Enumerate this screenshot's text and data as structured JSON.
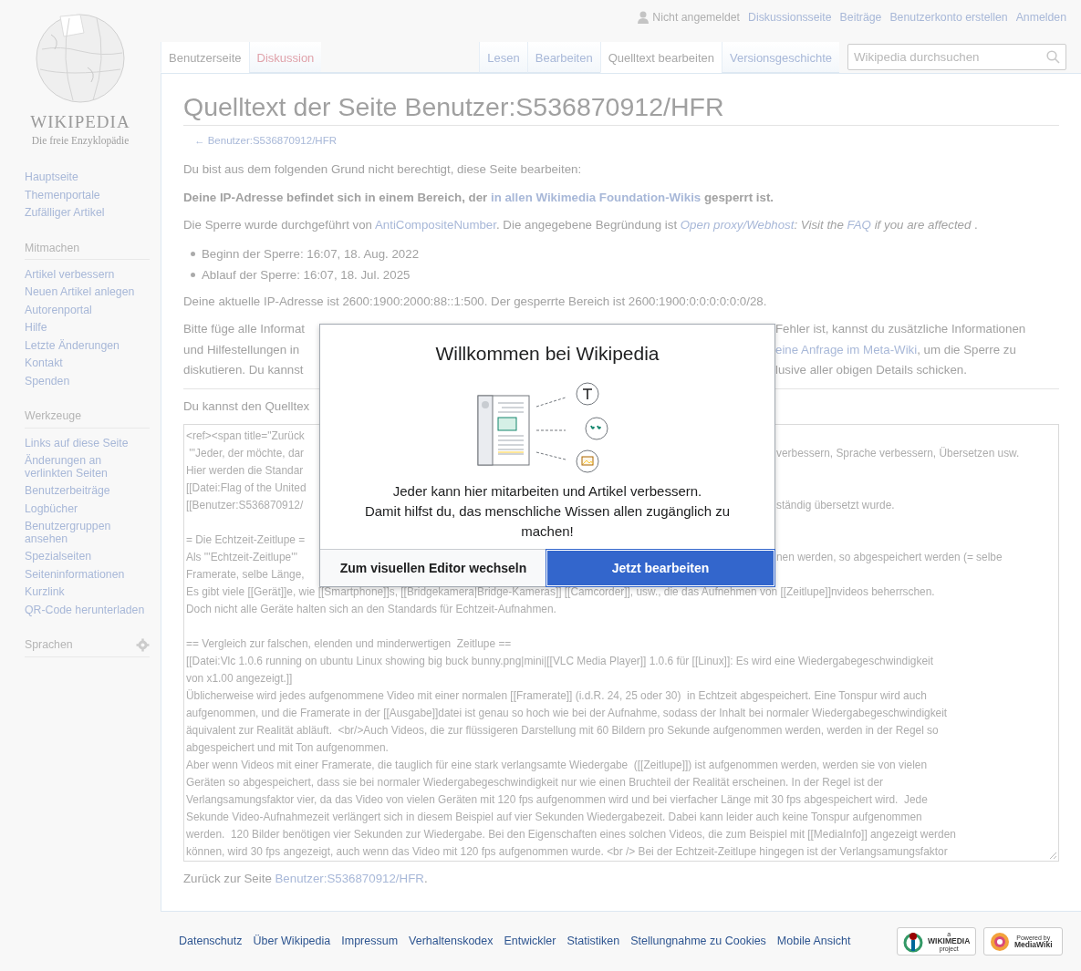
{
  "logo": {
    "wordmark": "WIKIPEDIA",
    "tagline": "Die freie Enzyklopädie"
  },
  "personal": {
    "status": "Nicht angemeldet",
    "links": [
      "Diskussionsseite",
      "Beiträge",
      "Benutzerkonto erstellen",
      "Anmelden"
    ]
  },
  "tabs_left": [
    {
      "label": "Benutzerseite",
      "selected": true,
      "kind": "existing"
    },
    {
      "label": "Diskussion",
      "selected": false,
      "kind": "missing"
    }
  ],
  "tabs_right": [
    {
      "label": "Lesen",
      "selected": false
    },
    {
      "label": "Bearbeiten",
      "selected": false
    },
    {
      "label": "Quelltext bearbeiten",
      "selected": true
    },
    {
      "label": "Versionsgeschichte",
      "selected": false
    }
  ],
  "search": {
    "placeholder": "Wikipedia durchsuchen"
  },
  "sidebar": {
    "sections": [
      {
        "items": [
          "Hauptseite",
          "Themenportale",
          "Zufälliger Artikel"
        ]
      },
      {
        "heading": "Mitmachen",
        "items": [
          "Artikel verbessern",
          "Neuen Artikel anlegen",
          "Autorenportal",
          "Hilfe",
          "Letzte Änderungen",
          "Kontakt",
          "Spenden"
        ]
      },
      {
        "heading": "Werkzeuge",
        "items": [
          "Links auf diese Seite",
          "Änderungen an verlinkten Seiten",
          "Benutzerbeiträge",
          "Logbücher",
          "Benutzergruppen ansehen",
          "Spezialseiten",
          "Seiteninformationen",
          "Kurzlink",
          "QR-Code herunterladen"
        ]
      },
      {
        "heading": "Sprachen",
        "settings": true
      }
    ]
  },
  "heading": "Quelltext der Seite Benutzer:S536870912/HFR",
  "back_link": "← Benutzer:S536870912/HFR",
  "content": [
    {
      "kind": "para",
      "bold": false,
      "lines": [
        {
          "kind": "line",
          "parts": [
            {
              "kind": "text",
              "text": "Du bist aus dem folgenden Grund nicht berechtigt, diese Seite bearbeiten:"
            }
          ]
        }
      ]
    },
    {
      "kind": "para",
      "bold": true,
      "lines": [
        {
          "kind": "line",
          "parts": [
            {
              "kind": "text",
              "text": "Deine IP-Adresse befindet sich in einem Bereich, der "
            },
            {
              "kind": "link",
              "text": "in allen Wikimedia Foundation-Wikis"
            },
            {
              "kind": "text",
              "text": " gesperrt ist."
            }
          ]
        }
      ]
    },
    {
      "kind": "para",
      "bold": false,
      "lines": [
        {
          "kind": "line",
          "parts": [
            {
              "kind": "text",
              "text": "Die Sperre wurde durchgeführt von "
            },
            {
              "kind": "link",
              "text": "AntiCompositeNumber"
            },
            {
              "kind": "text",
              "text": ". Die angegebene Begründung ist "
            },
            {
              "kind": "italic-link",
              "text": "Open proxy/Webhost"
            },
            {
              "kind": "italic",
              "text": ": Visit the "
            },
            {
              "kind": "italic-link",
              "text": "FAQ"
            },
            {
              "kind": "italic",
              "text": " if you are affected"
            },
            {
              "kind": "text",
              "text": " ."
            }
          ]
        }
      ]
    },
    {
      "kind": "list",
      "items": [
        "Beginn der Sperre: 16:07, 18. Aug. 2022",
        "Ablauf der Sperre: 16:07, 18. Jul. 2025"
      ]
    },
    {
      "kind": "para",
      "bold": false,
      "lines": [
        {
          "kind": "line",
          "parts": [
            {
              "kind": "text",
              "text": "Deine aktuelle IP-Adresse ist 2600:1900:2000:88::1:500. Der gesperrte Bereich ist 2600:1900:0:0:0:0:0:0/28."
            }
          ]
        }
      ]
    },
    {
      "kind": "para",
      "bold": false,
      "lines": [
        {
          "kind": "split",
          "parts": [
            {
              "kind": "text",
              "text": "Bitte füge alle Informat"
            }
          ],
          "right": [
            {
              "kind": "text",
              "text": "Fehler ist, kannst du zusätzliche Informationen"
            }
          ]
        },
        {
          "kind": "split",
          "parts": [
            {
              "kind": "text",
              "text": "und Hilfestellungen in"
            }
          ],
          "right": [
            {
              "kind": "link",
              "text": "eine Anfrage im Meta-Wiki"
            },
            {
              "kind": "text",
              "text": ", um die Sperre zu"
            }
          ]
        },
        {
          "kind": "split",
          "parts": [
            {
              "kind": "text",
              "text": "diskutieren. Du kannst"
            }
          ],
          "right": [
            {
              "kind": "text",
              "text": "lusive aller obigen Details schicken."
            }
          ]
        }
      ]
    },
    {
      "kind": "rule"
    },
    {
      "kind": "para",
      "bold": false,
      "lines": [
        {
          "kind": "split",
          "parts": [
            {
              "kind": "text",
              "text": "Du kannst den Quelltex"
            }
          ]
        }
      ]
    },
    {
      "kind": "editor",
      "lines": [
        {
          "kind": "split",
          "text": "<ref><span title=\"Zurück"
        },
        {
          "kind": "split",
          "text": " '''Jeder, der möchte, dar",
          "right": "verbessern, Sprache verbessern, Übersetzen usw."
        },
        {
          "kind": "split",
          "text": "Hier werden die Standar"
        },
        {
          "kind": "split",
          "text": "[[Datei:Flag of the United"
        },
        {
          "kind": "split",
          "text": "[[Benutzer:S536870912/",
          "right": "ständig übersetzt wurde."
        },
        {
          "kind": "blank"
        },
        {
          "kind": "split",
          "text": "= Die Echtzeit-Zeitlupe ="
        },
        {
          "kind": "split",
          "text": "Als '''Echtzeit-Zeitlupe'''",
          "right": "nen werden, so abgespeichert werden (= selbe"
        },
        {
          "kind": "split",
          "text": "Framerate, selbe Länge,"
        },
        {
          "kind": "line",
          "text": "Es gibt viele [[Gerät]]e, wie [[Smartphone]]s, [[Bridgekamera|Bridge-Kameras]] [[Camcorder]], usw., die das Aufnehmen von [[Zeitlupe]]nvideos beherrschen."
        },
        {
          "kind": "line",
          "text": "Doch nicht alle Geräte halten sich an den Standards für Echtzeit-Aufnahmen."
        },
        {
          "kind": "blank"
        },
        {
          "kind": "line",
          "text": "== Vergleich zur falschen, elenden und minderwertigen  Zeitlupe =="
        },
        {
          "kind": "line",
          "text": "[[Datei:Vlc 1.0.6 running on ubuntu Linux showing big buck bunny.png|mini|[[VLC Media Player]] 1.0.6 für [[Linux]]: Es wird eine Wiedergabegeschwindigkeit"
        },
        {
          "kind": "line",
          "text": "von x1.00 angezeigt.]]"
        },
        {
          "kind": "line",
          "text": "Üblicherweise wird jedes aufgenommene Video mit einer normalen [[Framerate]] (i.d.R. 24, 25 oder 30)  in Echtzeit abgespeichert. Eine Tonspur wird auch"
        },
        {
          "kind": "line",
          "text": "aufgenommen, und die Framerate in der [[Ausgabe]]datei ist genau so hoch wie bei der Aufnahme, sodass der Inhalt bei normaler Wiedergabegeschwindigkeit"
        },
        {
          "kind": "line",
          "text": "äquivalent zur Realität abläuft.  <br/>Auch Videos, die zur flüssigeren Darstellung mit 60 Bildern pro Sekunde aufgenommen werden, werden in der Regel so"
        },
        {
          "kind": "line",
          "text": "abgespeichert und mit Ton aufgenommen."
        },
        {
          "kind": "line",
          "text": "Aber wenn Videos mit einer Framerate, die tauglich für eine stark verlangsamte Wiedergabe  ([[Zeitlupe]]) ist aufgenommen werden, werden sie von vielen"
        },
        {
          "kind": "line",
          "text": "Geräten so abgespeichert, dass sie bei normaler Wiedergabegeschwindigkeit nur wie einen Bruchteil der Realität erscheinen. In der Regel ist der"
        },
        {
          "kind": "line",
          "text": "Verlangsamungsfaktor vier, da das Video von vielen Geräten mit 120 fps aufgenommen wird und bei vierfacher Länge mit 30 fps abgespeichert wird.  Jede"
        },
        {
          "kind": "line",
          "text": "Sekunde Video-Aufnahmezeit verlängert sich in diesem Beispiel auf vier Sekunden Wiedergabezeit. Dabei kann leider auch keine Tonspur aufgenommen"
        },
        {
          "kind": "line",
          "text": "werden.  120 Bilder benötigen vier Sekunden zur Wiedergabe. Bei den Eigenschaften eines solchen Videos, die zum Beispiel mit [[MediaInfo]] angezeigt werden"
        },
        {
          "kind": "line",
          "text": "können, wird 30 fps angezeigt, auch wenn das Video mit 120 fps aufgenommen wurde. <br /> Bei der Echtzeit-Zeitlupe hingegen ist der Verlangsamungsfaktor"
        }
      ]
    },
    {
      "kind": "para",
      "bold": false,
      "lines": [
        {
          "kind": "line",
          "parts": [
            {
              "kind": "text",
              "text": "Zurück zur Seite "
            },
            {
              "kind": "link",
              "text": "Benutzer:S536870912/HFR"
            },
            {
              "kind": "text",
              "text": "."
            }
          ]
        }
      ]
    }
  ],
  "modal": {
    "title": "Willkommen bei Wikipedia",
    "body": [
      "Jeder kann hier mitarbeiten und Artikel verbessern.",
      "Damit hilfst du, das menschliche Wissen allen zugänglich zu machen!"
    ],
    "buttons": [
      {
        "label": "Zum visuellen Editor wechseln",
        "kind": "secondary"
      },
      {
        "label": "Jetzt bearbeiten",
        "kind": "primary"
      }
    ]
  },
  "footer": {
    "links": [
      "Datenschutz",
      "Über Wikipedia",
      "Impressum",
      "Verhaltenskodex",
      "Entwickler",
      "Statistiken",
      "Stellungnahme zu Cookies",
      "Mobile Ansicht"
    ],
    "badges": [
      {
        "kind": "wikimedia",
        "lines": [
          "a",
          "WIKIMEDIA",
          "project"
        ]
      },
      {
        "kind": "mediawiki",
        "lines": [
          "Powered by",
          "MediaWiki"
        ]
      }
    ]
  }
}
